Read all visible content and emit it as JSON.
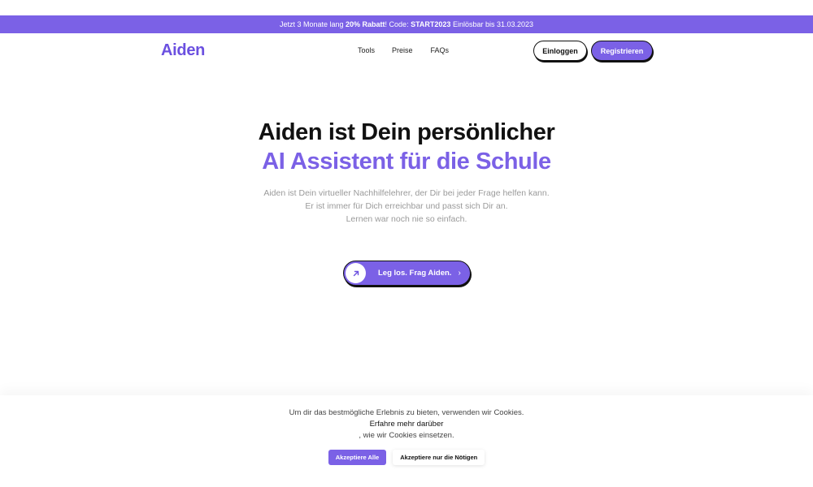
{
  "colors": {
    "accent": "#7b61e6",
    "text": "#111111",
    "muted": "#9a9a9a"
  },
  "promo": {
    "prefix": "Jetzt 3 Monate lang ",
    "discount": "20% Rabatt",
    "middle": "! Code: ",
    "code": "START2023",
    "suffix": " Einlösbar bis 31.03.2023"
  },
  "header": {
    "logo": "Aiden",
    "nav": [
      "Tools",
      "Preise",
      "FAQs"
    ],
    "login_label": "Einloggen",
    "register_label": "Registrieren"
  },
  "hero": {
    "title_line1": "Aiden ist Dein persönlicher",
    "title_line2": "AI Assistent für die Schule",
    "subtitle": [
      "Aiden ist Dein virtueller Nachhilfelehrer, der Dir bei jeder Frage helfen kann.",
      "Er ist immer für Dich erreichbar und passt sich Dir an.",
      "Lernen war noch nie so einfach."
    ],
    "cta_label": "Leg los. Frag Aiden.",
    "cta_icon": "arrow-up-right-icon",
    "cta_chevron": "›"
  },
  "cookie": {
    "line1": "Um dir das bestmögliche Erlebnis zu bieten, verwenden wir Cookies.",
    "link_text": "Erfahre mehr darüber",
    "line2_rest": ", wie wir Cookies einsetzen.",
    "accept_all_label": "Akzeptiere Alle",
    "accept_needed_label": "Akzeptiere nur die Nötigen"
  }
}
